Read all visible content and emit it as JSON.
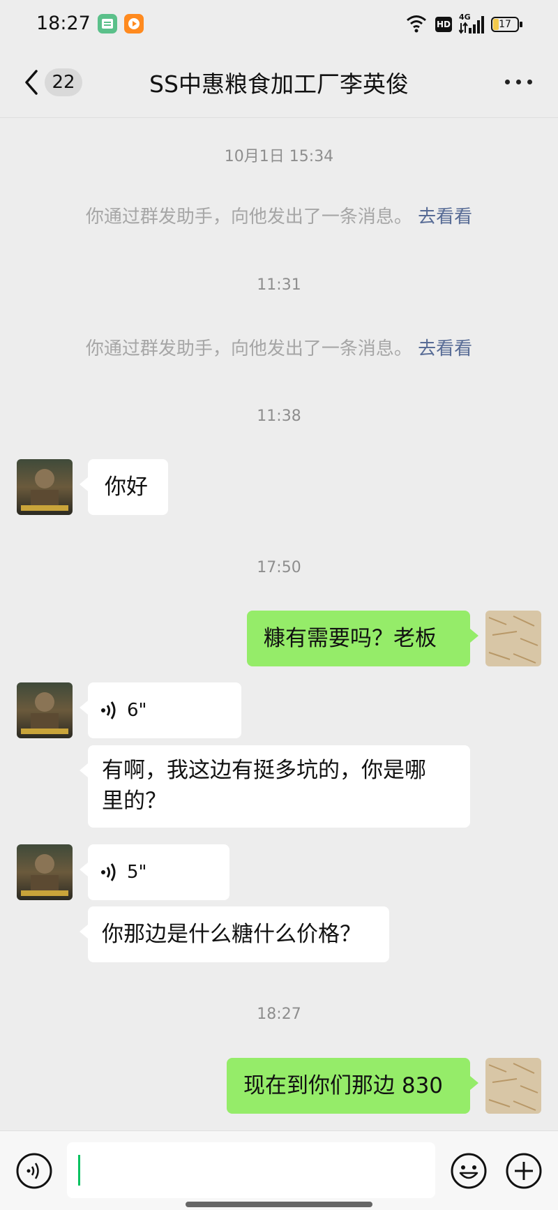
{
  "status_bar": {
    "time": "18:27",
    "battery": "17",
    "network": "4G",
    "hd": "HD"
  },
  "header": {
    "back_count": "22",
    "title": "SS中惠粮食加工厂李英俊"
  },
  "messages": {
    "ts1": "10月1日 15:34",
    "sys1": "你通过群发助手，向他发出了一条消息。",
    "sys1_link": "去看看",
    "ts2": "11:31",
    "sys2": "你通过群发助手，向他发出了一条消息。",
    "sys2_link": "去看看",
    "ts3": "11:38",
    "m1": "你好",
    "ts4": "17:50",
    "m2": "糠有需要吗？老板",
    "v1": "6\"",
    "m3_line1": "有啊，我这边有挺多坑的，你是哪",
    "m3_line2": "里的？",
    "v2": "5\"",
    "m4": "你那边是什么糖什么价格？",
    "ts5": "18:27",
    "m5": "现在到你们那边 830"
  },
  "colors": {
    "bubble_out": "#95ec69",
    "bubble_in": "#ffffff",
    "link": "#576b95",
    "background": "#ededed"
  }
}
